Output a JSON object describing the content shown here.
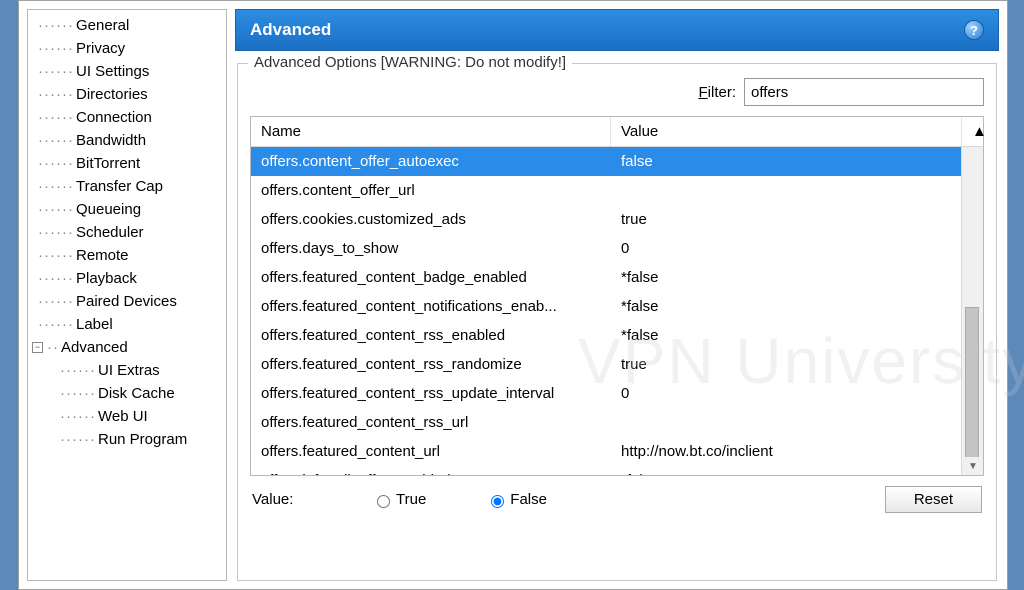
{
  "header": {
    "title": "Advanced",
    "help_tooltip": "?"
  },
  "sidebar": {
    "items": [
      {
        "label": "General",
        "type": "leaf"
      },
      {
        "label": "Privacy",
        "type": "leaf"
      },
      {
        "label": "UI Settings",
        "type": "leaf"
      },
      {
        "label": "Directories",
        "type": "leaf"
      },
      {
        "label": "Connection",
        "type": "leaf"
      },
      {
        "label": "Bandwidth",
        "type": "leaf"
      },
      {
        "label": "BitTorrent",
        "type": "leaf"
      },
      {
        "label": "Transfer Cap",
        "type": "leaf"
      },
      {
        "label": "Queueing",
        "type": "leaf"
      },
      {
        "label": "Scheduler",
        "type": "leaf"
      },
      {
        "label": "Remote",
        "type": "leaf"
      },
      {
        "label": "Playback",
        "type": "leaf"
      },
      {
        "label": "Paired Devices",
        "type": "leaf"
      },
      {
        "label": "Label",
        "type": "leaf"
      },
      {
        "label": "Advanced",
        "type": "parent",
        "expanded": true
      },
      {
        "label": "UI Extras",
        "type": "child"
      },
      {
        "label": "Disk Cache",
        "type": "child"
      },
      {
        "label": "Web UI",
        "type": "child"
      },
      {
        "label": "Run Program",
        "type": "child"
      }
    ]
  },
  "options_group": {
    "legend": "Advanced Options [WARNING: Do not modify!]",
    "filter_label_pre": "F",
    "filter_label_post": "ilter:",
    "filter_value": "offers"
  },
  "table": {
    "columns": {
      "name": "Name",
      "value": "Value"
    },
    "rows": [
      {
        "name": "offers.content_offer_autoexec",
        "value": "false",
        "selected": true
      },
      {
        "name": "offers.content_offer_url",
        "value": ""
      },
      {
        "name": "offers.cookies.customized_ads",
        "value": "true"
      },
      {
        "name": "offers.days_to_show",
        "value": "0"
      },
      {
        "name": "offers.featured_content_badge_enabled",
        "value": "*false"
      },
      {
        "name": "offers.featured_content_notifications_enab...",
        "value": "*false"
      },
      {
        "name": "offers.featured_content_rss_enabled",
        "value": "*false"
      },
      {
        "name": "offers.featured_content_rss_randomize",
        "value": "true"
      },
      {
        "name": "offers.featured_content_rss_update_interval",
        "value": "0"
      },
      {
        "name": "offers.featured_content_rss_url",
        "value": ""
      },
      {
        "name": "offers.featured_content_url",
        "value": "http://now.bt.co/inclient"
      },
      {
        "name": "offers.left_rail_offer_enabled",
        "value": "*false"
      }
    ]
  },
  "value_row": {
    "label": "Value:",
    "true_label": "True",
    "false_label": "False",
    "selected": "false",
    "reset_label": "Reset"
  },
  "watermark": "VPN University"
}
